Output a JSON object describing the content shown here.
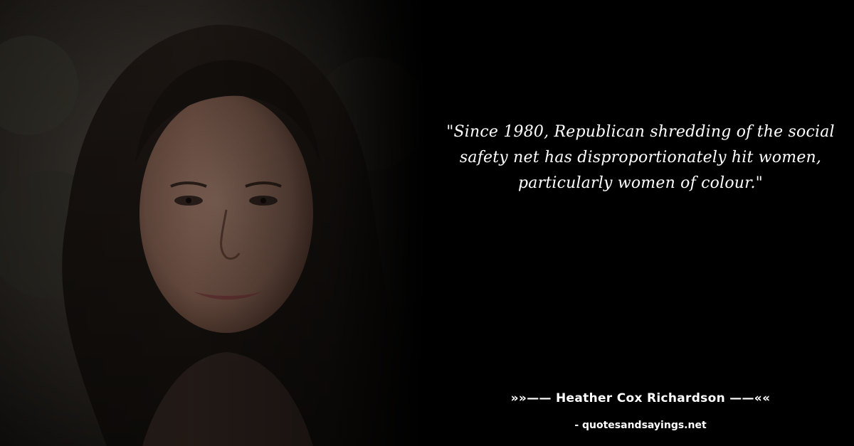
{
  "quote": {
    "text": "\"Since 1980, Republican shredding of the social safety net has disproportionately hit women, particularly women of colour.\""
  },
  "attribution": {
    "author_line": "»»—— Heather Cox Richardson ——««",
    "source_line": "- quotesandsayings.net"
  }
}
